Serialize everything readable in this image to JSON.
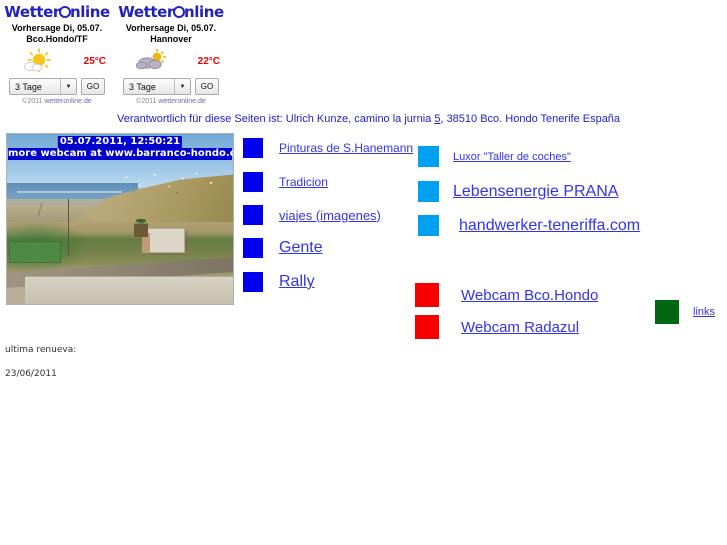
{
  "weather": {
    "widgets": [
      {
        "logo_pre": "Wetter",
        "logo_post": "nline",
        "forecast_label": "Vorhersage Di, 05.07.",
        "location": "Bco.Hondo/TF",
        "condition_icon": "sun-with-cloud-icon",
        "temperature": "25°C",
        "range_value": "3 Tage",
        "go_label": "GO",
        "copyright": "©2011 ",
        "copyright_link": "wetteronline.de"
      },
      {
        "logo_pre": "Wetter",
        "logo_post": "nline",
        "forecast_label": "Vorhersage Di, 05.07.",
        "location": "Hannover",
        "condition_icon": "cloud-with-sun-icon",
        "temperature": "22°C",
        "range_value": "3 Tage",
        "go_label": "GO",
        "copyright": "©2011 ",
        "copyright_link": "wetteronline.de"
      }
    ]
  },
  "responsibility": {
    "part1": "Verantwortlich für diese Seiten ist: Ulrich Kunze, camino la jurnia ",
    "link": "5",
    "part2": ", 38510 Bco. Hondo Tenerife España"
  },
  "webcam": {
    "timestamp": "05.07.2011, 12:50:21",
    "caption": "more webcam at www.barranco-hondo.com"
  },
  "colors": {
    "blue_swatch": "#0000ee",
    "cyan_swatch": "#00a0f0",
    "red_swatch": "#f80000",
    "green_swatch": "#006611",
    "link": "#3333ee"
  },
  "link_groups": {
    "blue_column": [
      {
        "label": "Pinturas de S.Hanemann",
        "font_size": "12px"
      },
      {
        "label": "Tradicion",
        "font_size": "12px"
      },
      {
        "label": "viajes (imagenes)",
        "font_size": "13px"
      },
      {
        "label": "Gente",
        "font_size": "16px"
      },
      {
        "label": "Rally",
        "font_size": "16px"
      }
    ],
    "cyan_column": [
      {
        "label": "Luxor \"Taller de coches\"",
        "font_size": "11px"
      },
      {
        "label": "Lebensenergie  PRANA",
        "font_size": "16px"
      },
      {
        "label": "handwerker-teneriffa.com",
        "font_size": "16px"
      }
    ],
    "red_column": [
      {
        "label": "Webcam Bco.Hondo",
        "font_size": "15px"
      },
      {
        "label": "Webcam Radazul",
        "font_size": "15px"
      }
    ],
    "green_column": [
      {
        "label": "links",
        "font_size": "11px"
      }
    ]
  },
  "footer": {
    "updated_label": "ultima renueva:",
    "updated_date": "23/06/2011"
  }
}
